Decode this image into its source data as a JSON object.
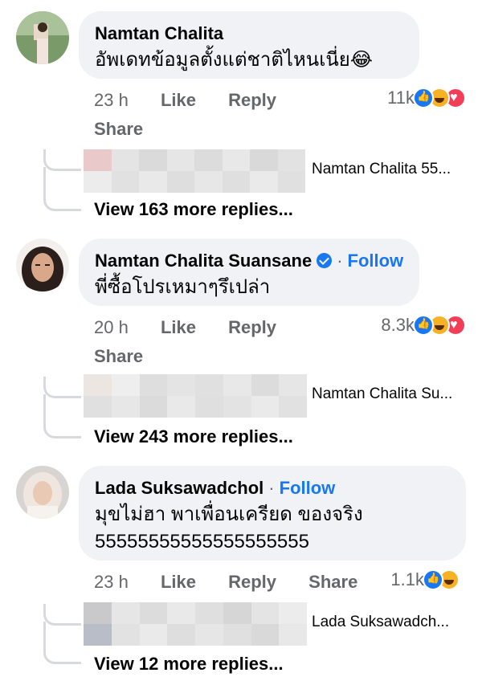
{
  "comments": [
    {
      "author": "Namtan Chalita",
      "verified": false,
      "follow": "",
      "text": [
        "อัพเดทข้อมูลตั้งแต่ชาติไหนเนี่ย😂"
      ],
      "time": "23 h",
      "like": "Like",
      "reply": "Reply",
      "share": "Share",
      "reaction_count": "11k",
      "reactions": [
        "like-icon",
        "haha-icon",
        "love-icon"
      ],
      "preview_name": "Namtan Chalita 55...",
      "view_more": "View 163 more replies..."
    },
    {
      "author": "Namtan Chalita Suansane",
      "verified": true,
      "dot": "·",
      "follow": "Follow",
      "text": [
        "พี่ซื้อโปรเหมาๆรึเปล่า"
      ],
      "time": "20 h",
      "like": "Like",
      "reply": "Reply",
      "share": "Share",
      "reaction_count": "8.3k",
      "reactions": [
        "like-icon",
        "haha-icon",
        "love-icon"
      ],
      "preview_name": "Namtan Chalita Su...",
      "view_more": "View 243 more replies..."
    },
    {
      "author": "Lada Suksawadchol",
      "verified": false,
      "dot": "·",
      "follow": "Follow",
      "text": [
        "มุขไม่ฮา พาเพื่อนเครียด ของจริง",
        "55555555555555555555"
      ],
      "time": "23 h",
      "like": "Like",
      "reply": "Reply",
      "share": "Share",
      "reaction_count": "1.1k",
      "reactions": [
        "like-icon",
        "haha-icon"
      ],
      "preview_name": "Lada Suksawadch...",
      "view_more": "View 12 more replies..."
    }
  ],
  "colors": {
    "link_blue": "#1877f2",
    "bubble_bg": "#f0f2f5",
    "meta_gray": "#65676b",
    "thread_line": "#d7d9dd"
  }
}
